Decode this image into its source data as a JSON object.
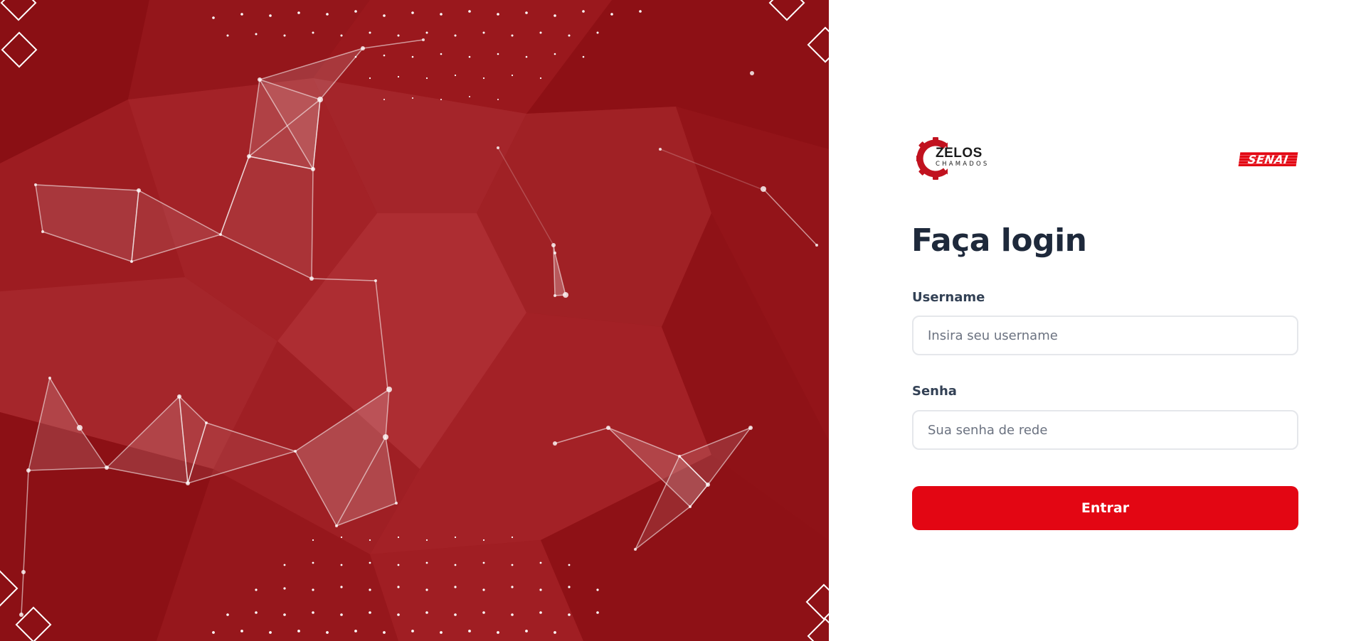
{
  "brand": {
    "app_name": "ZELOS",
    "app_tagline": "CHAMADOS",
    "partner_logo": "SENAI",
    "accent_color": "#e30613",
    "hero_color": "#9c1a1e"
  },
  "login": {
    "title": "Faça login",
    "username_label": "Username",
    "username_placeholder": "Insira seu username",
    "password_label": "Senha",
    "password_placeholder": "Sua senha de rede",
    "submit_label": "Entrar"
  },
  "icons": {
    "logo_mark": "gear-icon"
  }
}
